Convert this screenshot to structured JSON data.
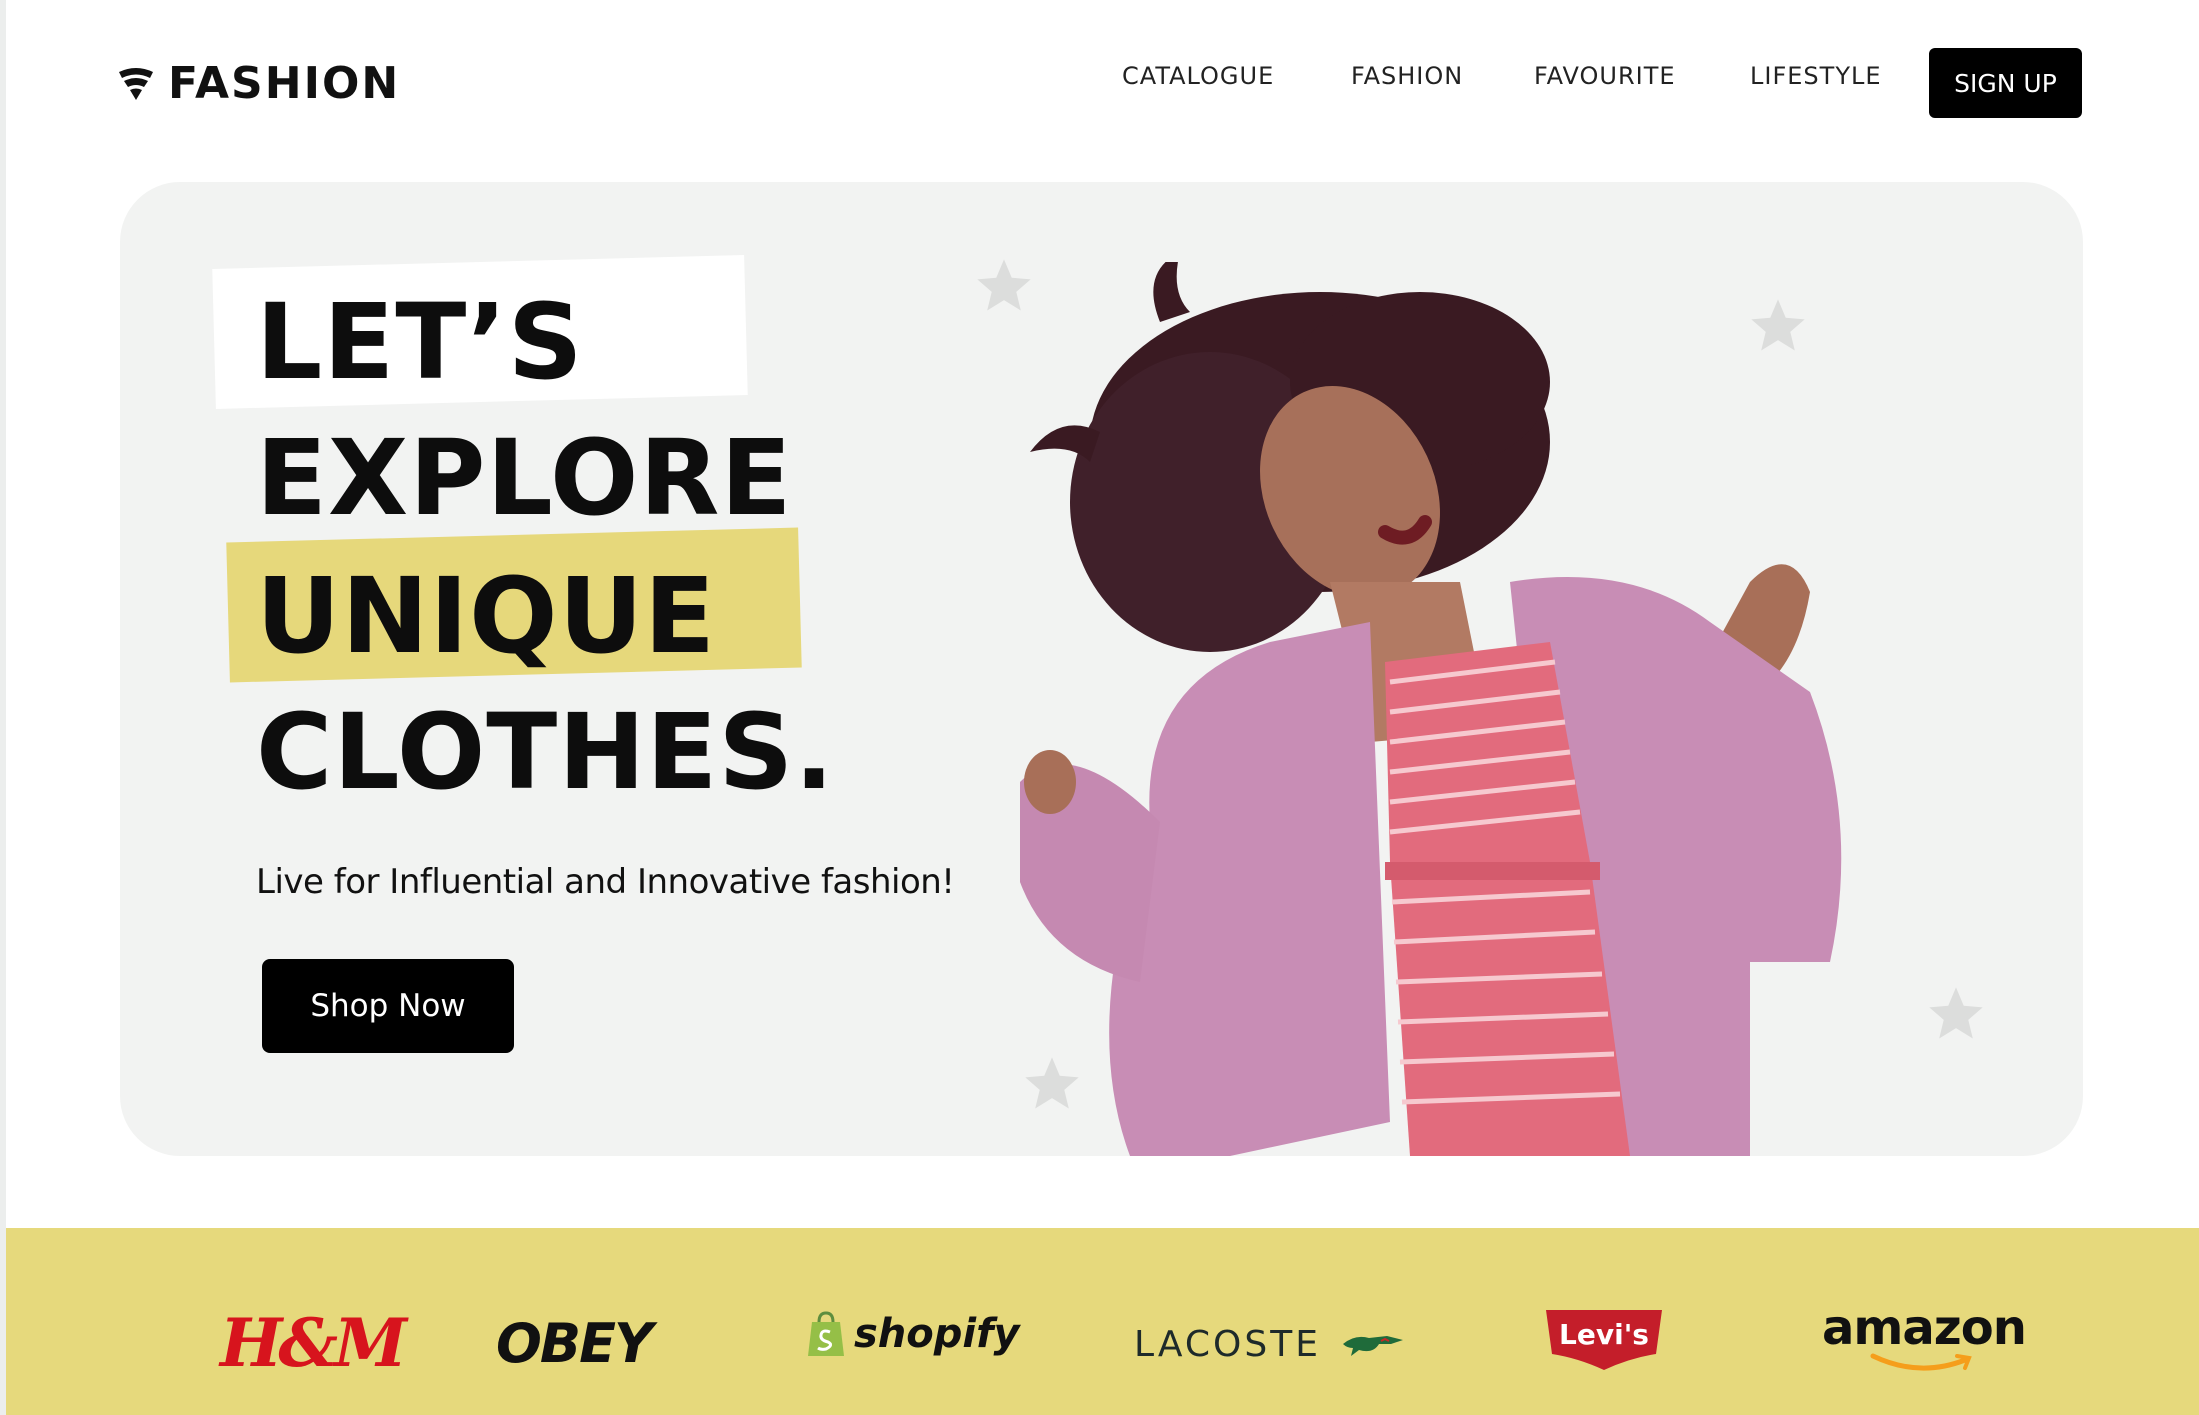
{
  "header": {
    "logo_text": "FASHION",
    "nav": [
      "CATALOGUE",
      "FASHION",
      "FAVOURITE",
      "LIFESTYLE"
    ],
    "signup_label": "SIGN UP"
  },
  "hero": {
    "headline": [
      "LET’S",
      "EXPLORE",
      "UNIQUE",
      "CLOTHES."
    ],
    "subtitle": "Live for Influential and Innovative fashion!",
    "cta_label": "Shop Now"
  },
  "brands": [
    "H&M",
    "OBEY",
    "shopify",
    "LACOSTE",
    "Levi's",
    "amazon"
  ],
  "colors": {
    "accent_yellow": "#e6d97c",
    "hero_bg": "#f2f3f2",
    "button": "#000000",
    "hm_red": "#d7141d",
    "levis_red": "#c41e2a",
    "shopify_green": "#95bf47",
    "lacoste_green": "#1f6b3a",
    "amazon_orange": "#f59e1b"
  },
  "icons": [
    "logo-wifi-shield-icon",
    "star-icon",
    "crocodile-icon",
    "shopify-bag-icon",
    "amazon-smile-icon"
  ]
}
